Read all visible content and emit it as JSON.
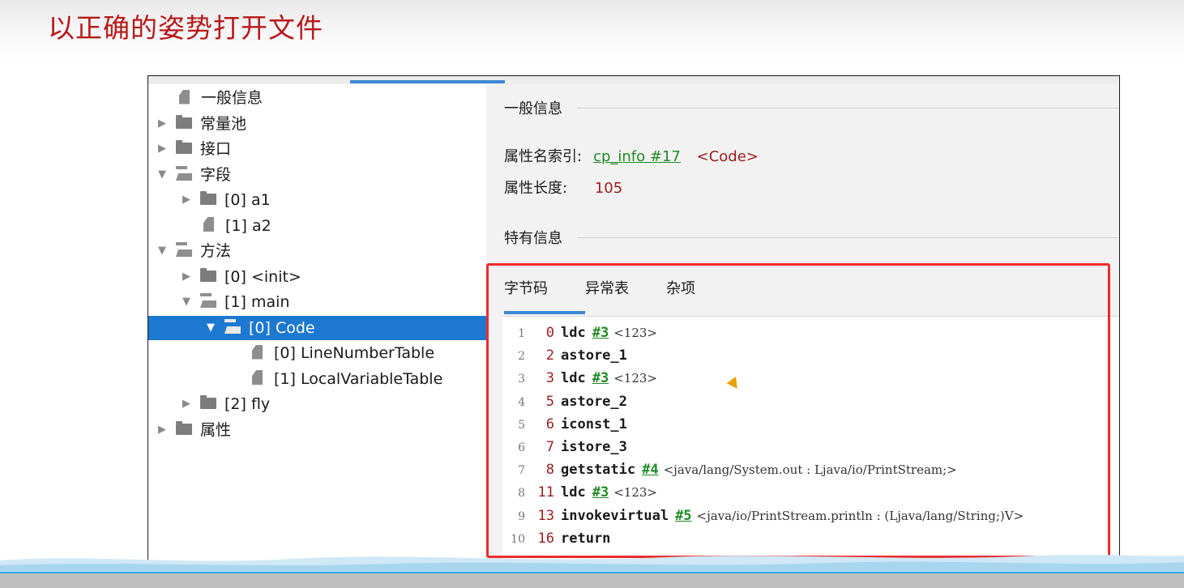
{
  "slide": {
    "title": "以正确的姿势打开文件"
  },
  "tree": {
    "items": [
      {
        "label": "一般信息",
        "arrow": "",
        "icon": "file"
      },
      {
        "label": "常量池",
        "arrow": "▶",
        "icon": "folder-closed"
      },
      {
        "label": "接口",
        "arrow": "▶",
        "icon": "folder-closed"
      },
      {
        "label": "字段",
        "arrow": "▼",
        "icon": "folder-open"
      },
      {
        "label": "[0] a1",
        "arrow": "▶",
        "icon": "folder-closed"
      },
      {
        "label": "[1] a2",
        "arrow": "",
        "icon": "file"
      },
      {
        "label": "方法",
        "arrow": "▼",
        "icon": "folder-open"
      },
      {
        "label": "[0] <init>",
        "arrow": "▶",
        "icon": "folder-closed"
      },
      {
        "label": "[1] main",
        "arrow": "▼",
        "icon": "folder-open"
      },
      {
        "label": "[0] Code",
        "arrow": "▼",
        "icon": "folder-open",
        "selected": true
      },
      {
        "label": "[0] LineNumberTable",
        "arrow": "",
        "icon": "file"
      },
      {
        "label": "[1] LocalVariableTable",
        "arrow": "",
        "icon": "file"
      },
      {
        "label": "[2] fly",
        "arrow": "▶",
        "icon": "folder-closed"
      },
      {
        "label": "属性",
        "arrow": "▶",
        "icon": "folder-closed"
      }
    ]
  },
  "general": {
    "title": "一般信息",
    "name_index_label": "属性名索引:",
    "name_index_link": "cp_info #17",
    "name_index_value": "<Code>",
    "length_label": "属性长度:",
    "length_value": "105"
  },
  "specific": {
    "title": "特有信息",
    "tabs": [
      "字节码",
      "异常表",
      "杂项"
    ],
    "active_tab": "字节码"
  },
  "bytecode": [
    {
      "ln": "1",
      "off": "0",
      "op": "ldc",
      "ref": "#3",
      "comment": "<123>"
    },
    {
      "ln": "2",
      "off": "2",
      "op": "astore_1",
      "ref": "",
      "comment": ""
    },
    {
      "ln": "3",
      "off": "3",
      "op": "ldc",
      "ref": "#3",
      "comment": "<123>"
    },
    {
      "ln": "4",
      "off": "5",
      "op": "astore_2",
      "ref": "",
      "comment": ""
    },
    {
      "ln": "5",
      "off": "6",
      "op": "iconst_1",
      "ref": "",
      "comment": ""
    },
    {
      "ln": "6",
      "off": "7",
      "op": "istore_3",
      "ref": "",
      "comment": ""
    },
    {
      "ln": "7",
      "off": "8",
      "op": "getstatic",
      "ref": "#4",
      "comment": "<java/lang/System.out : Ljava/io/PrintStream;>"
    },
    {
      "ln": "8",
      "off": "11",
      "op": "ldc",
      "ref": "#3",
      "comment": "<123>"
    },
    {
      "ln": "9",
      "off": "13",
      "op": "invokevirtual",
      "ref": "#5",
      "comment": "<java/io/PrintStream.println : (Ljava/lang/String;)V>"
    },
    {
      "ln": "10",
      "off": "16",
      "op": "return",
      "ref": "",
      "comment": ""
    }
  ],
  "colors": {
    "selection": "#1c78d1",
    "link": "#1f8a24",
    "value": "#9b1c1c",
    "highlight_box": "#ee2b2b",
    "title": "#b8191a"
  }
}
